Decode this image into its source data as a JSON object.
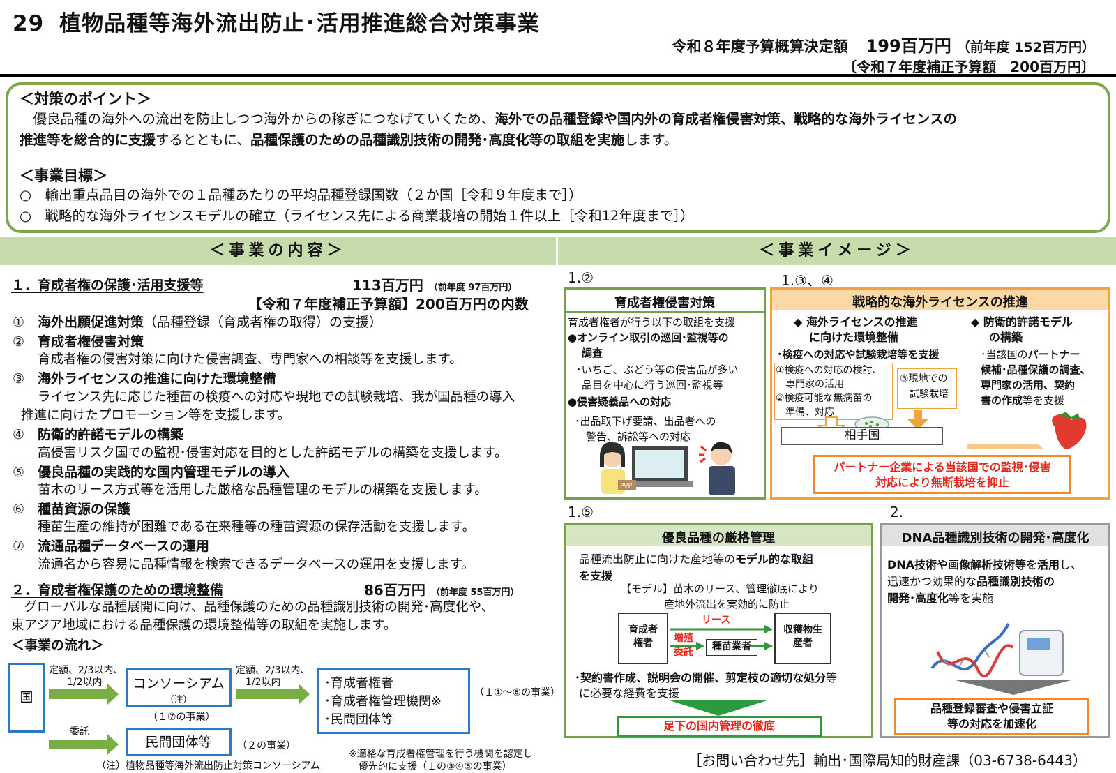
{
  "header": {
    "number": "29",
    "title": "植物品種等海外流出防止･活用推進総合対策事業",
    "budget_label": "令和８年度予算概算決定額",
    "budget_amount": "199百万円",
    "budget_prev": "（前年度 152百万円）",
    "supplementary": "〔令和７年度補正予算額　200百万円〕"
  },
  "points": {
    "heading": "＜対策のポイント＞",
    "line1_a": "　優良品種の海外への流出を防止しつつ海外からの稼ぎにつなげていくため、",
    "line1_b": "海外での品種登録や国内外の育成者権侵害対策、戦略的な海外ライセンスの",
    "line2_a": "推進等を総合的に支援",
    "line2_b": "するとともに、",
    "line2_c": "品種保護のための品種識別技術の開発･高度化等の取組を実施",
    "line2_d": "します。",
    "goal_heading": "＜事業目標＞",
    "goal1": "○　輸出重点品目の海外での１品種あたりの平均品種登録国数（２か国［令和９年度まで］）",
    "goal2": "○　戦略的な海外ライセンスモデルの確立（ライセンス先による商業栽培の開始１件以上［令和12年度まで］）"
  },
  "bars": {
    "left": "＜事業の内容＞",
    "right": "＜事業イメージ＞"
  },
  "content": {
    "sec1_title": "１．育成者権の保護･活用支援等",
    "sec1_amount": "113百万円",
    "sec1_prev": "（前年度 97百万円）",
    "sec1_supp": "【令和７年度補正予算額】200百万円の内数",
    "items": [
      {
        "mark": "①",
        "title": "海外出願促進対策",
        "note": "（品種登録（育成者権の取得）の支援）",
        "desc": ""
      },
      {
        "mark": "②",
        "title": "育成者権侵害対策",
        "note": "",
        "desc": "育成者権の侵害対策に向けた侵害調査、専門家への相談等を支援します。"
      },
      {
        "mark": "③",
        "title": "海外ライセンスの推進に向けた環境整備",
        "note": "",
        "desc": "ライセンス先に応じた種苗の検疫への対応や現地での試験栽培、我が国品種の導入"
      },
      {
        "mark": "④",
        "title": "防衛的許諾モデルの構築",
        "note": "",
        "desc": "高侵害リスク国での監視･侵害対応を目的とした許諾モデルの構築を支援します。"
      },
      {
        "mark": "⑤",
        "title": "優良品種の実践的な国内管理モデルの導入",
        "note": "",
        "desc": "苗木のリース方式等を活用した厳格な品種管理のモデルの構築を支援します。"
      },
      {
        "mark": "⑥",
        "title": "種苗資源の保護",
        "note": "",
        "desc": "種苗生産の維持が困難である在来種等の種苗資源の保存活動を支援します。"
      },
      {
        "mark": "⑦",
        "title": "流通品種データベースの運用",
        "note": "",
        "desc": "流通名から容易に品種情報を検索できるデータベースの運用を支援します。"
      }
    ],
    "item3_desc2": "推進に向けたプロモーション等を支援します。",
    "sec2_title": "２．育成者権保護のための環境整備",
    "sec2_amount": "86百万円",
    "sec2_prev": "（前年度 55百万円）",
    "sec2_desc1": "　グローバルな品種展開に向け、品種保護のための品種識別技術の開発･高度化や、",
    "sec2_desc2": "東アジア地域における品種保護の環境整備等の取組を実施します。",
    "flow_heading": "＜事業の流れ＞"
  },
  "flow": {
    "country": "国",
    "arrow1": "定額、2/3以内、",
    "arrow1b": "1/2以内",
    "consortium": "コンソーシアム",
    "consortium_note": "（注）",
    "consortium_sub": "（１⑦の事業）",
    "arrow2": "定額、2/3以内、",
    "arrow2b": "1/2以内",
    "recipients": [
      "･育成者権者",
      "･育成者権管理機関※",
      "･民間団体等"
    ],
    "recipients_sub": "（１①～⑥の事業）",
    "delegate": "委託",
    "private": "民間団体等",
    "private_sub": "（２の事業）",
    "footnote1": "（注）植物品種等海外流出防止対策コンソーシアム",
    "footnote2": "※適格な育成者権管理を行う機関を認定し",
    "footnote3": "優先的に支援（１の③④⑤の事業）"
  },
  "images": {
    "label_a": "1.②",
    "label_b": "1.③、④",
    "label_c": "1.⑤",
    "label_d": "2.",
    "box_a": {
      "title": "育成者権侵害対策",
      "l1": "育成者権者が行う以下の取組を支援",
      "l2": "●オンライン取引の巡回･監視等の",
      "l3": "調査",
      "l4": "･いちご、ぶどう等の侵害品が多い",
      "l5": "品目を中心に行う巡回･監視等",
      "l6": "●侵害疑義品への対応",
      "l7": "･出品取下げ要請、出品者への",
      "l8": "警告、訴訟等への対応",
      "pvp": "PVP"
    },
    "box_b": {
      "title": "戦略的な海外ライセンスの推進",
      "h1a": "◆ 海外ライセンスの推進",
      "h1b": "に向けた環境整備",
      "h2a": "◆ 防衛的許諾モデル",
      "h2b": "の構築",
      "sub": "･検疫への対応や試験栽培等を支援",
      "q1": "①検疫への対応の検討、",
      "q2": "専門家の活用",
      "q3": "②検疫可能な無病苗の",
      "q4": "準備、対応",
      "q5": "③現地での",
      "q6": "試験栽培",
      "r1": "･当該国の",
      "r1b": "パートナー",
      "r2": "候補･品種保護の調査、",
      "r3": "専門家の活用、契約",
      "r4a": "書の作成",
      "r4b": "等を支援",
      "partner": "相手国",
      "result1": "パートナー企業による当該国での監視･侵害",
      "result2": "対応により無断栽培を抑止"
    },
    "box_c": {
      "title": "優良品種の厳格管理",
      "l1a": "品種流出防止に向けた産地等の",
      "l1b": "モデル的な取組",
      "l2": "を支援",
      "model1": "【モデル】苗木のリース、管理徹底により",
      "model2": "産地外流出を実効的に防止",
      "breeder": "育成者権者",
      "lease": "リース",
      "grow": "増殖",
      "entrust": "委託",
      "nursery": "種苗業者",
      "producer": "収穫物生産者",
      "l3a": "･契約書作成、説明会の開催、剪定枝の適切な処分",
      "l3b": "等",
      "l4": "に必要な経費を支援",
      "result": "足下の国内管理の徹底"
    },
    "box_d": {
      "title": "DNA品種識別技術の開発･高度化",
      "l1a": "DNA技術や画像解析技術等を活用",
      "l1b": "し、",
      "l2a": "迅速かつ効果的な",
      "l2b": "品種識別技術の",
      "l3a": "開発･高度化",
      "l3b": "等を実施",
      "result1": "品種登録審査や侵害立証",
      "result2": "等の対応を加速化"
    }
  },
  "contact": "［お問い合わせ先］輸出･国際局知的財産課（03-6738-6443）"
}
